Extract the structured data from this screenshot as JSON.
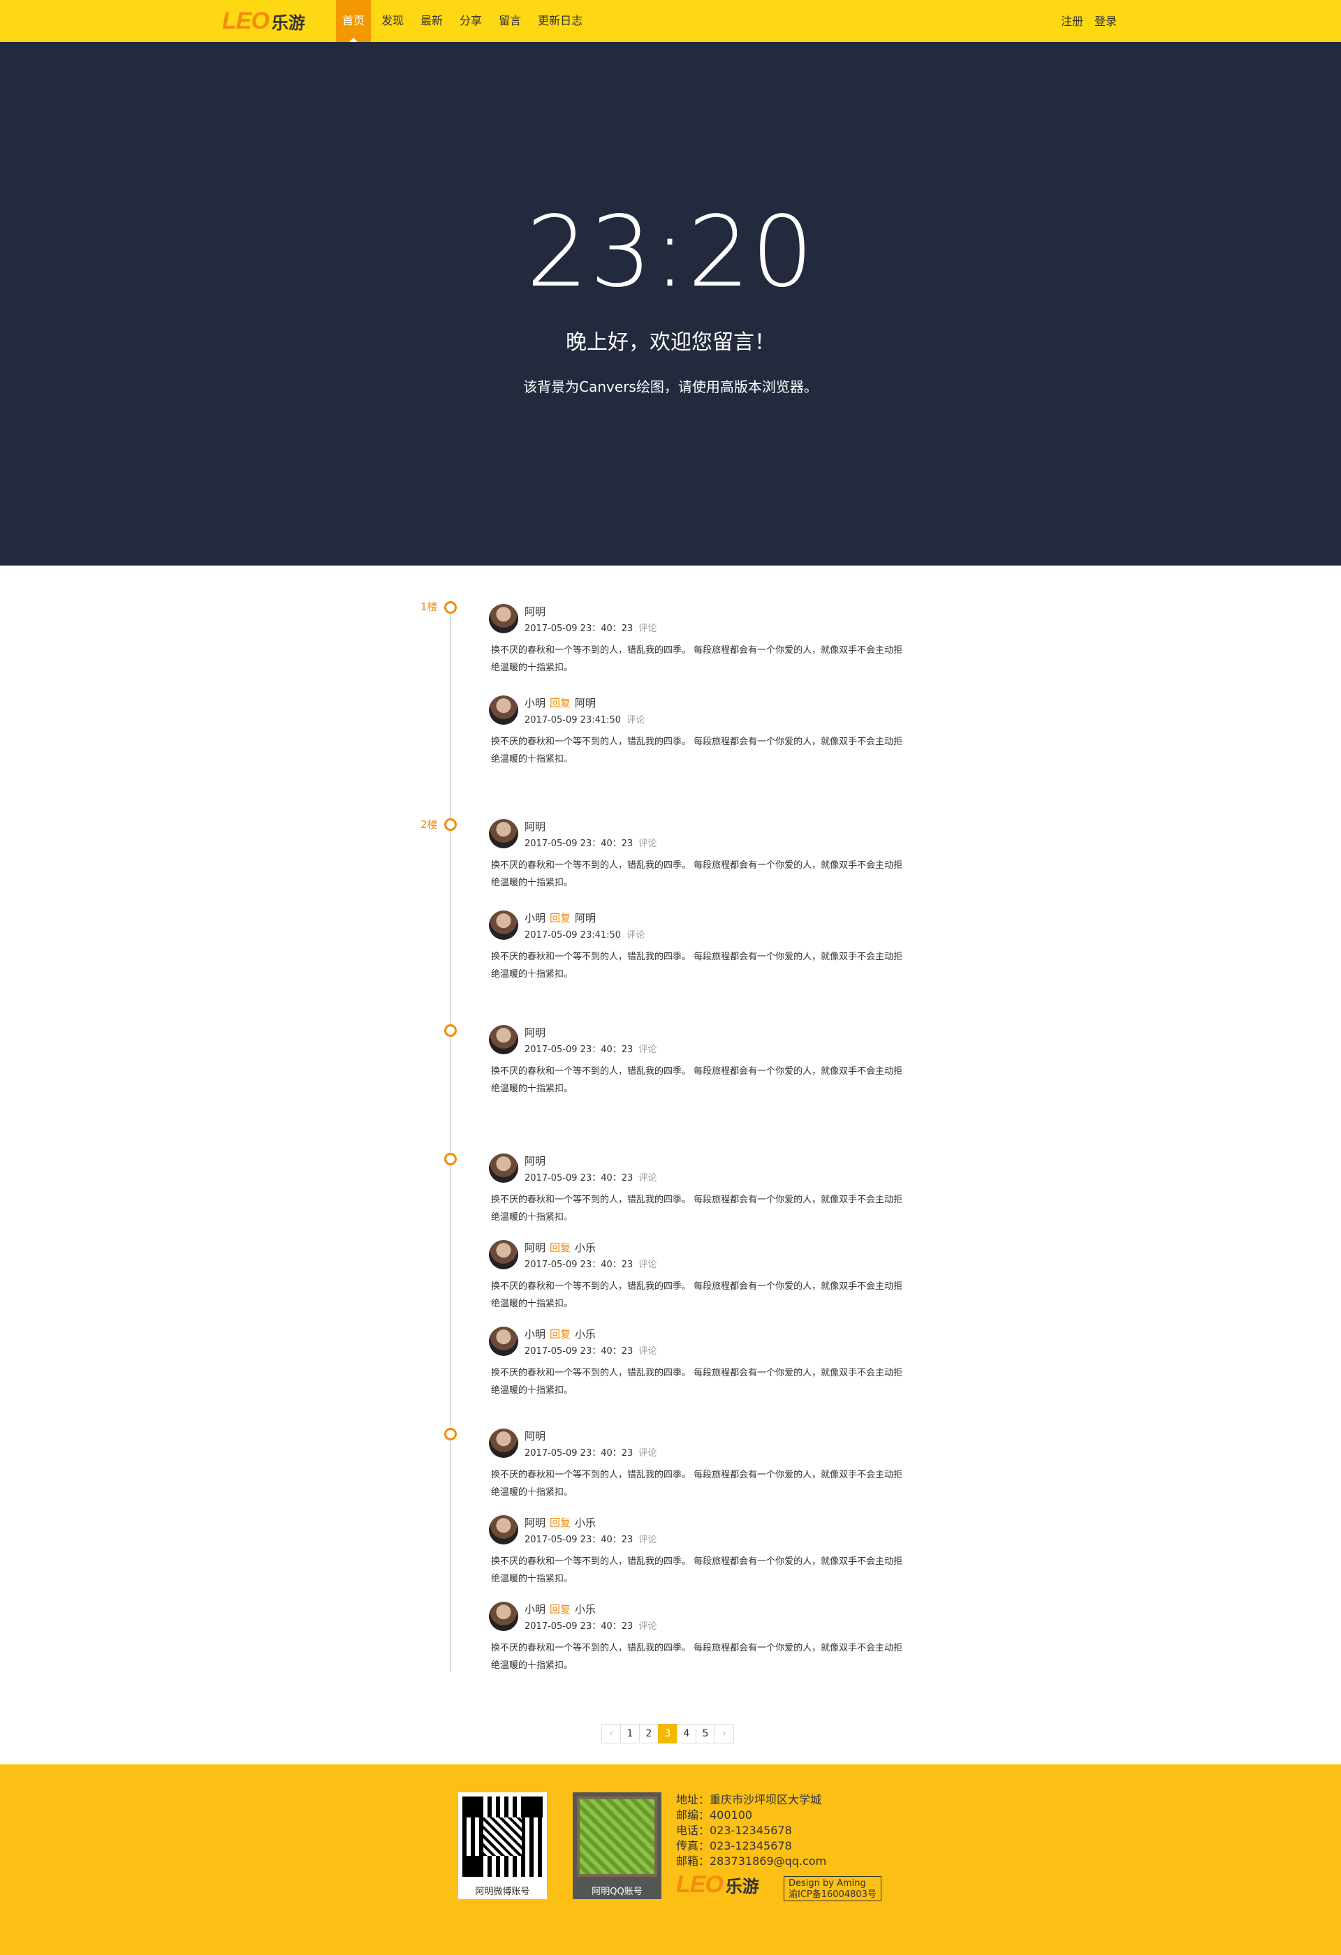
{
  "nav": {
    "logo_text": "LEO",
    "logo_cn": "乐游",
    "items": [
      "首页",
      "发现",
      "最新",
      "分享",
      "留言",
      "更新日志"
    ],
    "right": [
      "注册",
      "登录"
    ]
  },
  "hero": {
    "clock": "23:20",
    "greeting": "晚上好，欢迎您留言！",
    "hint": "该背景为Canvers绘图，请使用高版本浏览器。"
  },
  "floors": [
    "1楼",
    "2楼"
  ],
  "comments": [
    {
      "name": "阿明",
      "reply": "",
      "target": "",
      "date": "2017-05-09  23：40：23",
      "action": "评论",
      "text": "换不厌的春秋和一个等不到的人，错乱我的四季。 每段旅程都会有一个你爱的人，就像双手不会主动拒绝温暖的十指紧扣。"
    },
    {
      "name": "小明",
      "reply": "回复",
      "target": "阿明",
      "date": "2017-05-09  23:41:50",
      "action": "评论",
      "text": "换不厌的春秋和一个等不到的人，错乱我的四季。 每段旅程都会有一个你爱的人，就像双手不会主动拒绝温暖的十指紧扣。"
    },
    {
      "name": "阿明",
      "reply": "",
      "target": "",
      "date": "2017-05-09  23：40：23",
      "action": "评论",
      "text": "换不厌的春秋和一个等不到的人，错乱我的四季。 每段旅程都会有一个你爱的人，就像双手不会主动拒绝温暖的十指紧扣。"
    },
    {
      "name": "小明",
      "reply": "回复",
      "target": "阿明",
      "date": "2017-05-09  23:41:50",
      "action": "评论",
      "text": "换不厌的春秋和一个等不到的人，错乱我的四季。 每段旅程都会有一个你爱的人，就像双手不会主动拒绝温暖的十指紧扣。"
    },
    {
      "name": "阿明",
      "reply": "",
      "target": "",
      "date": "2017-05-09  23：40：23",
      "action": "评论",
      "text": "换不厌的春秋和一个等不到的人，错乱我的四季。 每段旅程都会有一个你爱的人，就像双手不会主动拒绝温暖的十指紧扣。"
    },
    {
      "name": "阿明",
      "reply": "",
      "target": "",
      "date": "2017-05-09  23：40：23",
      "action": "评论",
      "text": "换不厌的春秋和一个等不到的人，错乱我的四季。 每段旅程都会有一个你爱的人，就像双手不会主动拒绝温暖的十指紧扣。"
    },
    {
      "name": "阿明",
      "reply": "回复",
      "target": "小乐",
      "date": "2017-05-09  23：40：23",
      "action": "评论",
      "text": "换不厌的春秋和一个等不到的人，错乱我的四季。 每段旅程都会有一个你爱的人，就像双手不会主动拒绝温暖的十指紧扣。"
    },
    {
      "name": "小明",
      "reply": "回复",
      "target": "小乐",
      "date": "2017-05-09  23：40：23",
      "action": "评论",
      "text": "换不厌的春秋和一个等不到的人，错乱我的四季。 每段旅程都会有一个你爱的人，就像双手不会主动拒绝温暖的十指紧扣。"
    },
    {
      "name": "阿明",
      "reply": "",
      "target": "",
      "date": "2017-05-09  23：40：23",
      "action": "评论",
      "text": "换不厌的春秋和一个等不到的人，错乱我的四季。 每段旅程都会有一个你爱的人，就像双手不会主动拒绝温暖的十指紧扣。"
    },
    {
      "name": "阿明",
      "reply": "回复",
      "target": "小乐",
      "date": "2017-05-09  23：40：23",
      "action": "评论",
      "text": "换不厌的春秋和一个等不到的人，错乱我的四季。 每段旅程都会有一个你爱的人，就像双手不会主动拒绝温暖的十指紧扣。"
    },
    {
      "name": "小明",
      "reply": "回复",
      "target": "小乐",
      "date": "2017-05-09  23：40：23",
      "action": "评论",
      "text": "换不厌的春秋和一个等不到的人，错乱我的四季。 每段旅程都会有一个你爱的人，就像双手不会主动拒绝温暖的十指紧扣。"
    }
  ],
  "pager": {
    "prev": "‹",
    "pages": [
      "1",
      "2",
      "3",
      "4",
      "5"
    ],
    "next": "›",
    "current": "3"
  },
  "footer": {
    "qr1_label": "阿明微博账号",
    "qr2_label": "阿明QQ账号",
    "address": "地址：重庆市沙坪坝区大学城",
    "postcode": "邮编：400100",
    "phone": "电话：023-12345678",
    "fax": "传真：023-12345678",
    "email": "邮箱：283731869@qq.com",
    "logo_text": "LEO",
    "logo_cn": "乐游",
    "design": "Design by Aming",
    "icp": "渝ICP备16004803号"
  }
}
